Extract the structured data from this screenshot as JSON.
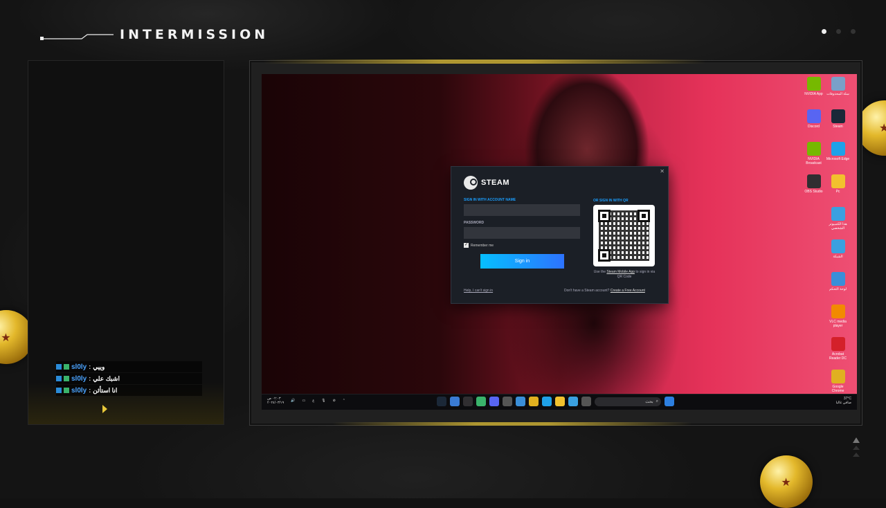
{
  "header": {
    "title": "INTERMISSION"
  },
  "pager": {
    "count": 3,
    "active": 0
  },
  "chat": {
    "messages": [
      {
        "user": "sl0ly",
        "sep": ":",
        "text": "وييي"
      },
      {
        "user": "sl0ly",
        "sep": ":",
        "text": "اشبك علي"
      },
      {
        "user": "sl0ly",
        "sep": ":",
        "text": "انا استأثن"
      }
    ]
  },
  "desktop_icons": [
    {
      "label": "NVIDIA App",
      "icon": "nvidia-icon",
      "color": "#76b900"
    },
    {
      "label": "سلة المحذوفات",
      "icon": "recycle-bin-icon",
      "color": "#7aa0c8"
    },
    {
      "label": "Discord",
      "icon": "discord-icon",
      "color": "#5865f2"
    },
    {
      "label": "Steam",
      "icon": "steam-icon",
      "color": "#1b2838"
    },
    {
      "label": "NVIDIA Broadcast",
      "icon": "nvidia-broadcast-icon",
      "color": "#76b900"
    },
    {
      "label": "Microsoft Edge",
      "icon": "edge-icon",
      "color": "#1fa1e8"
    },
    {
      "label": "OBS Studio",
      "icon": "obs-icon",
      "color": "#302e31"
    },
    {
      "label": "Pc",
      "icon": "folder-icon",
      "color": "#f2c12e"
    },
    {
      "label": "",
      "icon": "",
      "color": ""
    },
    {
      "label": "هذا الكمبيوتر الشخصي",
      "icon": "this-pc-icon",
      "color": "#3aa0e0"
    },
    {
      "label": "",
      "icon": "",
      "color": ""
    },
    {
      "label": "الشبكة",
      "icon": "network-icon",
      "color": "#3aa0e0"
    },
    {
      "label": "",
      "icon": "",
      "color": ""
    },
    {
      "label": "لوحة التحكم",
      "icon": "control-panel-icon",
      "color": "#3a8ed8"
    },
    {
      "label": "",
      "icon": "",
      "color": ""
    },
    {
      "label": "VLC media player",
      "icon": "vlc-icon",
      "color": "#f28a00"
    },
    {
      "label": "",
      "icon": "",
      "color": ""
    },
    {
      "label": "Acrobat Reader DC",
      "icon": "acrobat-icon",
      "color": "#d4202a"
    },
    {
      "label": "",
      "icon": "",
      "color": ""
    },
    {
      "label": "Google Chrome",
      "icon": "chrome-icon",
      "color": "#e0b020"
    }
  ],
  "steam_login": {
    "brand": "STEAM",
    "account_label": "SIGN IN WITH ACCOUNT NAME",
    "account_value": "",
    "password_label": "PASSWORD",
    "password_value": "",
    "remember_label": "Remember me",
    "remember_checked": true,
    "signin_label": "Sign in",
    "help_link": "Help, I can't sign in",
    "no_account_text": "Don't have a Steam account?",
    "create_link": "Create a Free Account",
    "qr_label": "OR SIGN IN WITH QR",
    "qr_note_prefix": "Use the",
    "qr_note_link": "Steam Mobile App",
    "qr_note_suffix": "to sign in via QR Code",
    "accent": "#1a9fff"
  },
  "taskbar": {
    "time": "٠٢:٠٣ ص",
    "date": "٢٠٢٤/٠٣/١٩",
    "lang": "ع",
    "search_placeholder": "بحث",
    "weather_temp": "37°C",
    "weather_text": "صافي غالبا",
    "pinned": [
      "steam-icon",
      "explorer-icon",
      "obs-icon",
      "play-icon",
      "discord-icon",
      "settings-icon",
      "store-icon",
      "chrome-icon",
      "edge-icon",
      "folder-icon",
      "network-icon",
      "mail-icon"
    ]
  }
}
